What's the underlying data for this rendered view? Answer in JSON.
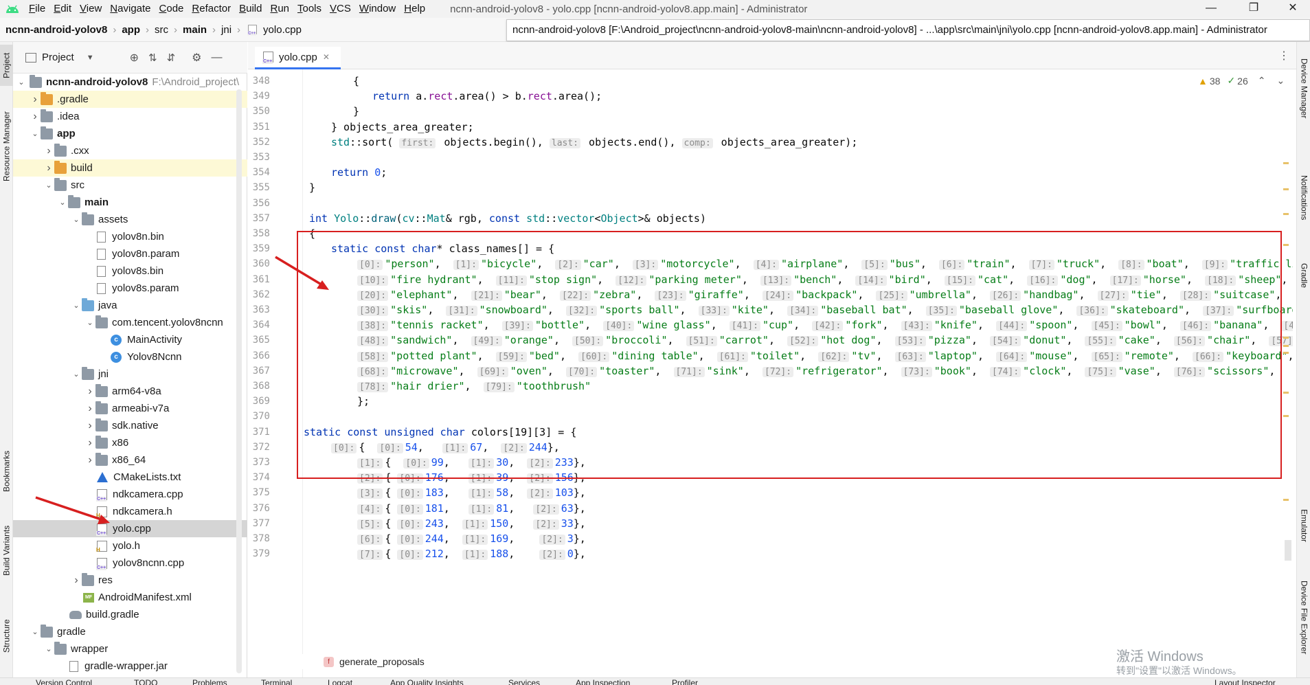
{
  "titlebar": {
    "menus": [
      "File",
      "Edit",
      "View",
      "Navigate",
      "Code",
      "Refactor",
      "Build",
      "Run",
      "Tools",
      "VCS",
      "Window",
      "Help"
    ],
    "window_title": "ncnn-android-yolov8 - yolo.cpp [ncnn-android-yolov8.app.main] - Administrator"
  },
  "breadcrumb": {
    "items": [
      "ncnn-android-yolov8",
      "app",
      "src",
      "main",
      "jni",
      "yolo.cpp"
    ]
  },
  "path_tooltip": "ncnn-android-yolov8 [F:\\Android_project\\ncnn-android-yolov8-main\\ncnn-android-yolov8] - ...\\app\\src\\main\\jni\\yolo.cpp [ncnn-android-yolov8.app.main] - Administrator",
  "left_strip": [
    "Project",
    "Resource Manager",
    "Bookmarks",
    "Build Variants",
    "Structure"
  ],
  "right_strip": [
    "Device Manager",
    "Notifications",
    "Gradle",
    "Emulator",
    "Device File Explorer"
  ],
  "project_panel": {
    "title": "Project",
    "root_name": "ncnn-android-yolov8",
    "root_path": "F:\\Android_project\\",
    "tree": [
      {
        "label": ".gradle",
        "depth": 1,
        "arrow": "right",
        "icon": "folder-orange",
        "hl": true
      },
      {
        "label": ".idea",
        "depth": 1,
        "arrow": "right",
        "icon": "folder"
      },
      {
        "label": "app",
        "depth": 1,
        "arrow": "down",
        "icon": "folder",
        "bold": true
      },
      {
        "label": ".cxx",
        "depth": 2,
        "arrow": "right",
        "icon": "folder"
      },
      {
        "label": "build",
        "depth": 2,
        "arrow": "right",
        "icon": "folder-orange",
        "hl": true
      },
      {
        "label": "src",
        "depth": 2,
        "arrow": "down",
        "icon": "folder"
      },
      {
        "label": "main",
        "depth": 3,
        "arrow": "down",
        "icon": "folder",
        "bold": true
      },
      {
        "label": "assets",
        "depth": 4,
        "arrow": "down",
        "icon": "folder"
      },
      {
        "label": "yolov8n.bin",
        "depth": 5,
        "icon": "file"
      },
      {
        "label": "yolov8n.param",
        "depth": 5,
        "icon": "file"
      },
      {
        "label": "yolov8s.bin",
        "depth": 5,
        "icon": "file"
      },
      {
        "label": "yolov8s.param",
        "depth": 5,
        "icon": "file"
      },
      {
        "label": "java",
        "depth": 4,
        "arrow": "down",
        "icon": "folder-blue"
      },
      {
        "label": "com.tencent.yolov8ncnn",
        "depth": 5,
        "arrow": "down",
        "icon": "folder"
      },
      {
        "label": "MainActivity",
        "depth": 6,
        "icon": "class"
      },
      {
        "label": "Yolov8Ncnn",
        "depth": 6,
        "icon": "class"
      },
      {
        "label": "jni",
        "depth": 4,
        "arrow": "down",
        "icon": "folder"
      },
      {
        "label": "arm64-v8a",
        "depth": 5,
        "arrow": "right",
        "icon": "folder"
      },
      {
        "label": "armeabi-v7a",
        "depth": 5,
        "arrow": "right",
        "icon": "folder"
      },
      {
        "label": "sdk.native",
        "depth": 5,
        "arrow": "right",
        "icon": "folder"
      },
      {
        "label": "x86",
        "depth": 5,
        "arrow": "right",
        "icon": "folder"
      },
      {
        "label": "x86_64",
        "depth": 5,
        "arrow": "right",
        "icon": "folder"
      },
      {
        "label": "CMakeLists.txt",
        "depth": 5,
        "icon": "cmake"
      },
      {
        "label": "ndkcamera.cpp",
        "depth": 5,
        "icon": "cpp"
      },
      {
        "label": "ndkcamera.h",
        "depth": 5,
        "icon": "h"
      },
      {
        "label": "yolo.cpp",
        "depth": 5,
        "icon": "cpp",
        "selected": true
      },
      {
        "label": "yolo.h",
        "depth": 5,
        "icon": "h"
      },
      {
        "label": "yolov8ncnn.cpp",
        "depth": 5,
        "icon": "cpp"
      },
      {
        "label": "res",
        "depth": 4,
        "arrow": "right",
        "icon": "folder"
      },
      {
        "label": "AndroidManifest.xml",
        "depth": 4,
        "icon": "mf"
      },
      {
        "label": "build.gradle",
        "depth": 3,
        "icon": "gradle"
      },
      {
        "label": "gradle",
        "depth": 1,
        "arrow": "down",
        "icon": "folder"
      },
      {
        "label": "wrapper",
        "depth": 2,
        "arrow": "down",
        "icon": "folder"
      },
      {
        "label": "gradle-wrapper.jar",
        "depth": 3,
        "icon": "file"
      }
    ]
  },
  "editor": {
    "tab_label": "yolo.cpp",
    "inspections": {
      "warnings": "38",
      "ok": "26"
    },
    "breadcrumb_bottom": "generate_proposals",
    "line_numbers": [
      "348",
      "349",
      "350",
      "351",
      "352",
      "353",
      "354",
      "355",
      "356",
      "357",
      "358",
      "359",
      "360",
      "361",
      "362",
      "363",
      "364",
      "365",
      "366",
      "367",
      "368",
      "369",
      "370",
      "371",
      "372",
      "373",
      "374",
      "375",
      "376",
      "377",
      "378",
      "379"
    ]
  },
  "bottom_tabs": [
    "Version Control",
    "TODO",
    "Problems",
    "Terminal",
    "Logcat",
    "App Quality Insights",
    "Services",
    "App Inspection",
    "Profiler",
    "Layout Inspector"
  ],
  "watermark": {
    "line1": "激活 Windows",
    "line2": "转到\"设置\"以激活 Windows。"
  },
  "colors": {
    "accent": "#3574f0",
    "annotation": "#d71f1f",
    "keyword": "#0033b3",
    "string": "#067d17",
    "number": "#1750eb"
  }
}
